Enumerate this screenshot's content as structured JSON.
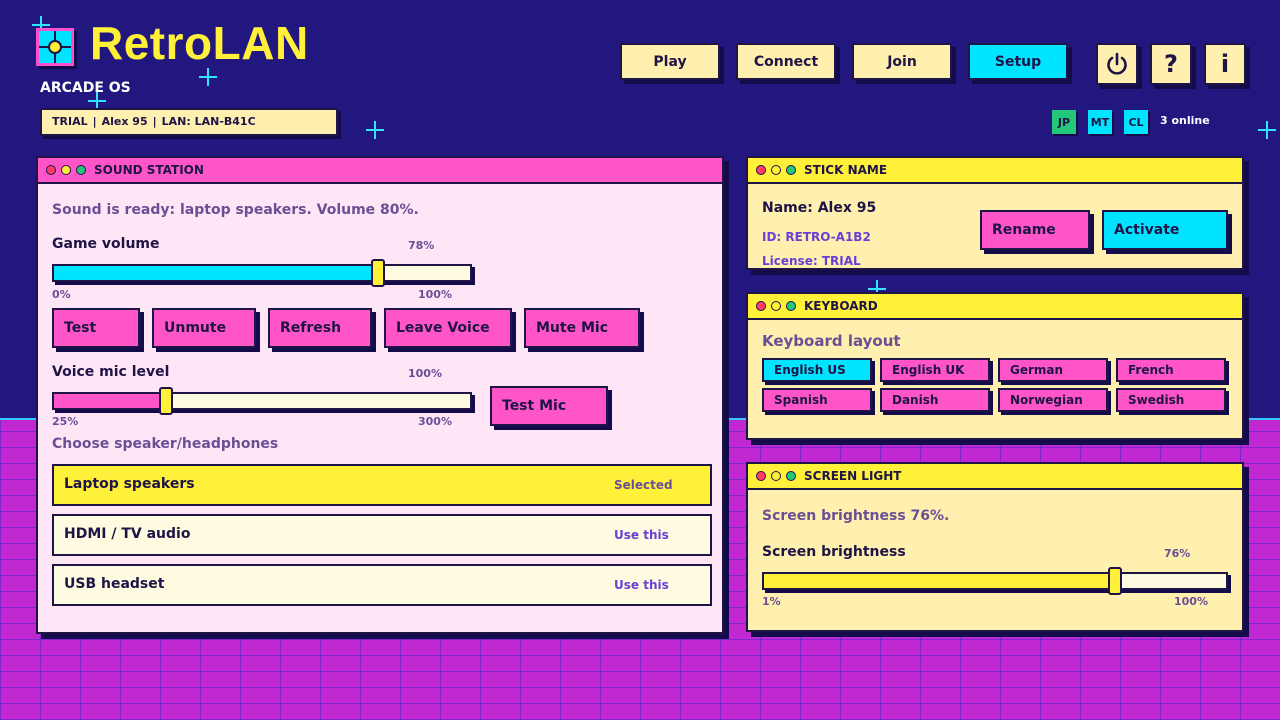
{
  "app": {
    "title": "RetroLAN",
    "subtitle": "ARCADE OS",
    "status": {
      "mode": "TRIAL",
      "user": "Alex 95",
      "lan": "LAN: LAN-B41C"
    }
  },
  "nav": {
    "buttons": [
      "Play",
      "Connect",
      "Join",
      "Setup"
    ],
    "active": "Setup",
    "icons": {
      "power": "power-icon",
      "help": "help-icon",
      "info": "info-icon"
    },
    "help_glyph": "?",
    "info_glyph": "i"
  },
  "online": {
    "users": [
      {
        "initials": "JP",
        "color": "#22c77a"
      },
      {
        "initials": "MT",
        "color": "#00e4ff"
      },
      {
        "initials": "CL",
        "color": "#00e4ff"
      }
    ],
    "count_text": "3 online"
  },
  "sound": {
    "title": "SOUND STATION",
    "status_text": "Sound is ready: laptop speakers. Volume 80%.",
    "game_volume": {
      "label": "Game volume",
      "value_text": "78%",
      "min_text": "0%",
      "max_text": "100%",
      "level": 0.78,
      "color": "#00e4ff"
    },
    "buttons": [
      "Test",
      "Unmute",
      "Refresh",
      "Leave Voice",
      "Mute Mic"
    ],
    "mic": {
      "label": "Voice mic level",
      "value_text": "100%",
      "min_text": "25%",
      "max_text": "300%",
      "level": 0.27,
      "color": "#ff55c8",
      "test_label": "Test Mic"
    },
    "device_label": "Choose speaker/headphones",
    "devices": [
      {
        "name": "Laptop speakers",
        "action": "Selected",
        "selected": true
      },
      {
        "name": "HDMI / TV audio",
        "action": "Use this",
        "selected": false
      },
      {
        "name": "USB headset",
        "action": "Use this",
        "selected": false
      }
    ]
  },
  "stick": {
    "title": "STICK NAME",
    "name_text": "Name: Alex 95",
    "id_text": "ID: RETRO-A1B2",
    "license_text": "License: TRIAL",
    "rename_label": "Rename",
    "activate_label": "Activate"
  },
  "keyboard": {
    "title": "KEYBOARD",
    "label": "Keyboard layout",
    "layouts": [
      "English US",
      "English UK",
      "German",
      "French",
      "Spanish",
      "Danish",
      "Norwegian",
      "Swedish"
    ],
    "selected": "English US"
  },
  "screen": {
    "title": "SCREEN LIGHT",
    "status_text": "Screen brightness 76%.",
    "brightness": {
      "label": "Screen brightness",
      "value_text": "76%",
      "min_text": "1%",
      "max_text": "100%",
      "level": 0.76,
      "color": "#fff03a"
    }
  }
}
